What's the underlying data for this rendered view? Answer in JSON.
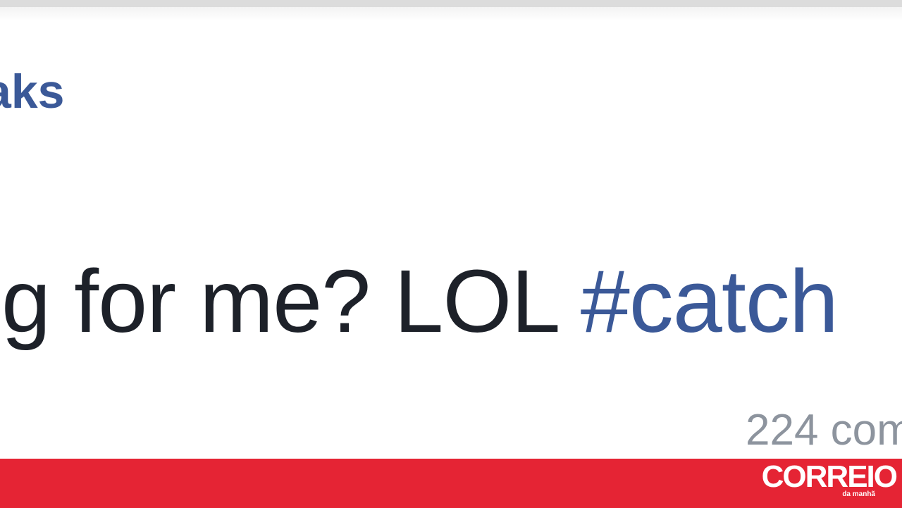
{
  "post": {
    "author_fragment": "aks",
    "text_fragment": "g for me? LOL ",
    "hashtag_fragment": "#catch",
    "comments_fragment": "224 com"
  },
  "branding": {
    "logo_main": "CORREIO",
    "logo_sub": "da manhã",
    "bar_color": "#e52434"
  },
  "colors": {
    "link": "#3b5998",
    "body_text": "#1d2129",
    "muted_text": "#8d949e"
  }
}
